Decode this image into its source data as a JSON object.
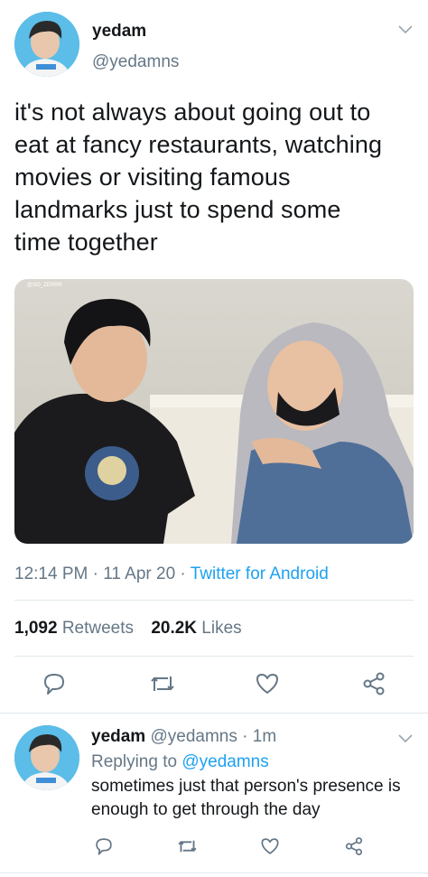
{
  "main_tweet": {
    "display_name": "yedam",
    "handle": "@yedamns",
    "text_lines": [
      "it's not always about going out to",
      "eat at fancy restaurants, watching",
      "movies or visiting famous",
      "landmarks just to spend some",
      "time together"
    ],
    "timestamp": "12:14 PM · 11 Apr 20 · ",
    "source": "Twitter for Android",
    "retweets_count": "1,092",
    "retweets_label": "Retweets",
    "likes_count": "20.2K",
    "likes_label": "Likes",
    "photo_watermark": "@SO_ZERRR"
  },
  "reply_tweet": {
    "display_name": "yedam",
    "handle_time": "@yedamns · 1m",
    "replying_prefix": "Replying to ",
    "replying_to": "@yedamns",
    "text_lines": [
      "sometimes just that person's presence is",
      "enough to get through the day"
    ]
  },
  "icons": [
    "reply-icon",
    "retweet-icon",
    "like-icon",
    "share-icon",
    "chevron-down-icon"
  ],
  "colors": {
    "link": "#1da1f2",
    "muted": "#657786",
    "text": "#14171a",
    "divider": "#e1e8ed"
  }
}
